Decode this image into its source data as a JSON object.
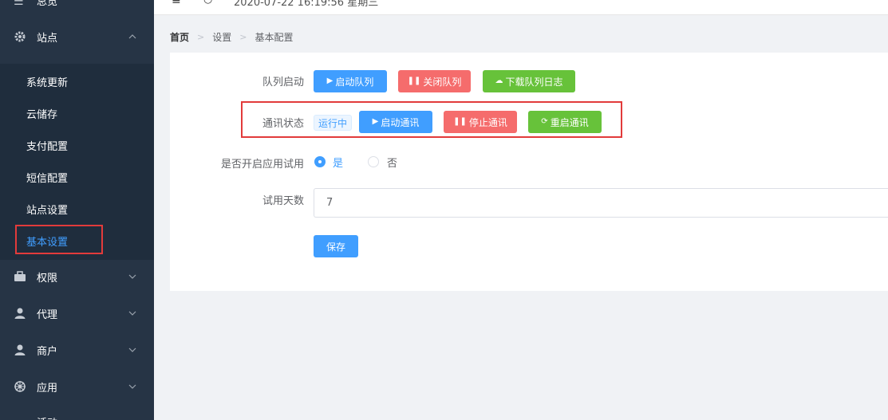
{
  "sidebar": {
    "top_item_label": "总览",
    "menus": [
      {
        "label": "站点",
        "icon": "gear-icon",
        "expanded": true
      },
      {
        "label": "权限",
        "icon": "briefcase-icon",
        "expanded": false
      },
      {
        "label": "代理",
        "icon": "user-icon",
        "expanded": false
      },
      {
        "label": "商户",
        "icon": "user-icon",
        "expanded": false
      },
      {
        "label": "应用",
        "icon": "helm-icon",
        "expanded": false
      }
    ],
    "submenu": [
      "系统更新",
      "云储存",
      "支付配置",
      "短信配置",
      "站点设置",
      "基本设置"
    ],
    "active_submenu": "基本设置",
    "bottom_partial_label": "活动"
  },
  "header": {
    "datetime": "2020-07-22 16:19:56 星期三"
  },
  "breadcrumb": [
    "首页",
    "设置",
    "基本配置"
  ],
  "form": {
    "queue": {
      "label": "队列启动",
      "buttons": [
        "启动队列",
        "关闭队列",
        "下载队列日志"
      ]
    },
    "comm": {
      "label": "通讯状态",
      "status": "运行中",
      "buttons": [
        "启动通讯",
        "停止通讯",
        "重启通讯"
      ]
    },
    "trial_enable": {
      "label": "是否开启应用试用",
      "options": [
        "是",
        "否"
      ],
      "selected": "是"
    },
    "trial_days": {
      "label": "试用天数",
      "value": "7"
    },
    "save_label": "保存"
  },
  "colors": {
    "sidebar_bg": "#263445",
    "submenu_bg": "#1f2d3d",
    "primary": "#409eff",
    "danger": "#f56c6c",
    "success": "#67c23a",
    "highlight_box": "#e23b3b"
  }
}
